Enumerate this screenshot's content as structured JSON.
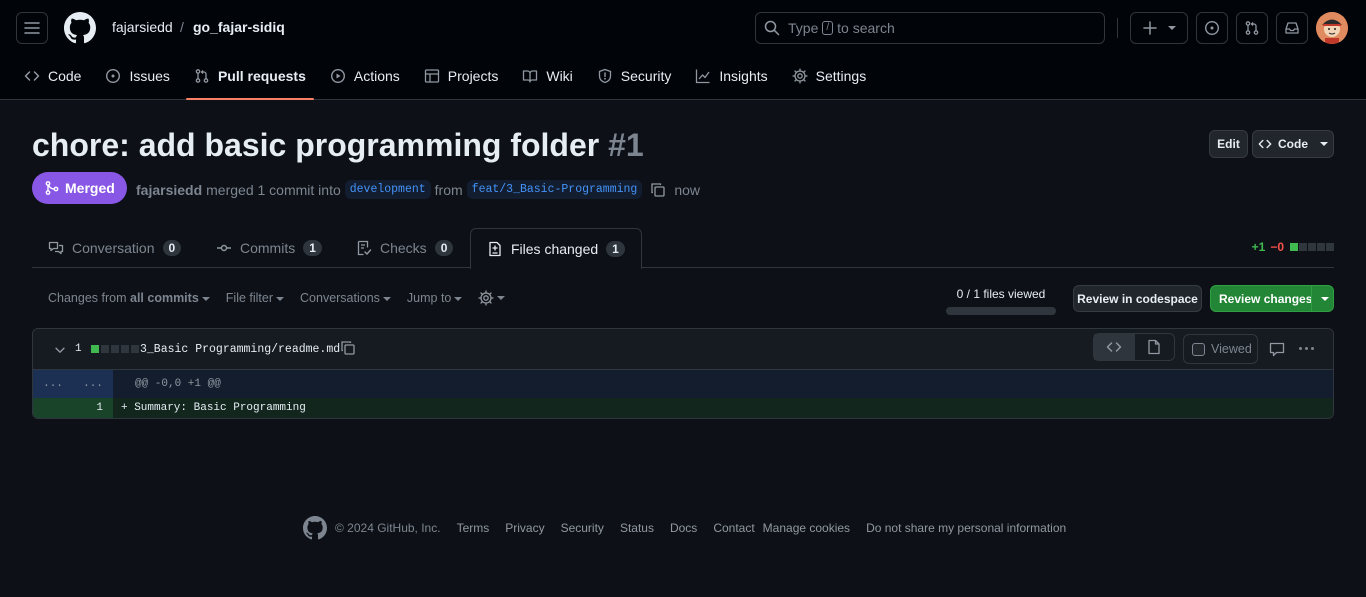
{
  "header": {
    "owner": "fajarsiedd",
    "separator": "/",
    "repo": "go_fajar-sidiq",
    "search": {
      "prefix": "Type",
      "key": "/",
      "suffix": "to search"
    }
  },
  "repo_tabs": [
    {
      "label": "Code",
      "icon": "code-icon"
    },
    {
      "label": "Issues",
      "icon": "issue-icon"
    },
    {
      "label": "Pull requests",
      "icon": "pull-request-icon",
      "active": true
    },
    {
      "label": "Actions",
      "icon": "play-icon"
    },
    {
      "label": "Projects",
      "icon": "table-icon"
    },
    {
      "label": "Wiki",
      "icon": "book-icon"
    },
    {
      "label": "Security",
      "icon": "shield-icon"
    },
    {
      "label": "Insights",
      "icon": "graph-icon"
    },
    {
      "label": "Settings",
      "icon": "gear-icon"
    }
  ],
  "pr": {
    "title": "chore: add basic programming folder",
    "number": "#1",
    "edit_label": "Edit",
    "code_label": "Code",
    "state": "Merged",
    "author": "fajarsiedd",
    "merged_text": "merged 1 commit into",
    "base_branch": "development",
    "from_text": "from",
    "head_branch": "feat/3_Basic-Programming",
    "time": "now"
  },
  "pr_tabs": [
    {
      "label": "Conversation",
      "count": "0",
      "icon": "comment-discussion-icon"
    },
    {
      "label": "Commits",
      "count": "1",
      "icon": "commit-icon"
    },
    {
      "label": "Checks",
      "count": "0",
      "icon": "checklist-icon"
    },
    {
      "label": "Files changed",
      "count": "1",
      "icon": "file-diff-icon",
      "active": true
    }
  ],
  "diffstat": {
    "additions": "+1",
    "deletions": "−0"
  },
  "toolbar": {
    "changes_prefix": "Changes from",
    "changes_value": "all commits",
    "file_filter": "File filter",
    "conversations": "Conversations",
    "jump_to": "Jump to",
    "files_viewed": "0 / 1 files viewed",
    "files_viewed_fraction": 0,
    "review_codespace": "Review in codespace",
    "review_changes": "Review changes"
  },
  "file": {
    "changes": "1",
    "path": "3_Basic Programming/readme.md",
    "viewed_label": "Viewed",
    "hunk_left": "...",
    "hunk_right": "...",
    "hunk_header": "@@ -0,0 +1 @@",
    "line_number": "1",
    "line_text": "+ Summary: Basic Programming"
  },
  "footer": {
    "copyright": "© 2024 GitHub, Inc.",
    "links": [
      "Terms",
      "Privacy",
      "Security",
      "Status",
      "Docs",
      "Contact",
      "Manage cookies",
      "Do not share my personal information"
    ]
  },
  "colors": {
    "merged": "#8957e5",
    "accent_tab": "#f78166",
    "add_green": "#3fb950",
    "del_red": "#f85149",
    "review_button": "#238636"
  }
}
